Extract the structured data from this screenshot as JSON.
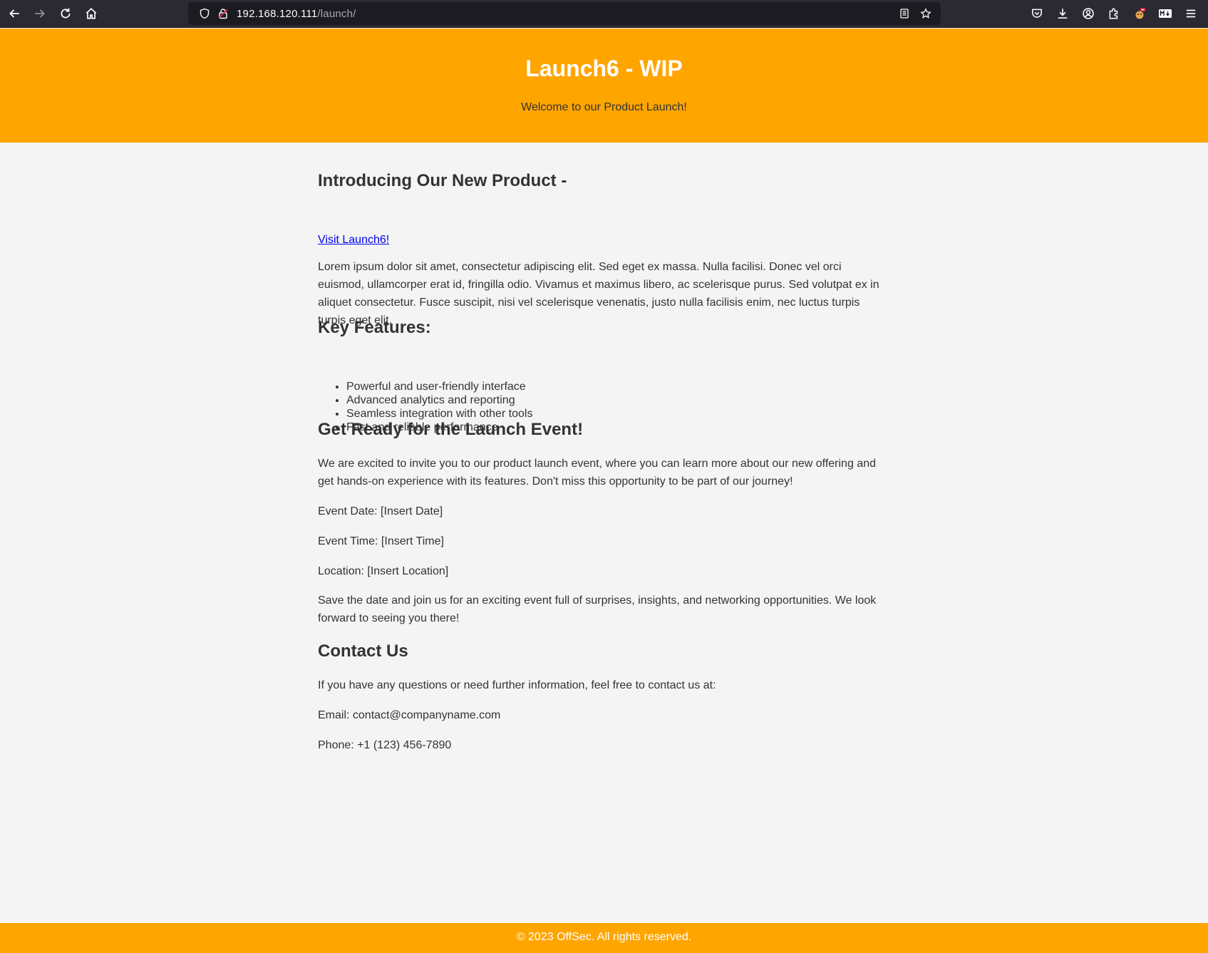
{
  "browser": {
    "url_host": "192.168.120.111",
    "url_path": "/launch/",
    "icons": {
      "back": "back-arrow-icon",
      "forward": "forward-arrow-icon",
      "reload": "reload-icon",
      "home": "home-icon",
      "shield": "tracking-protection-shield-icon",
      "lock": "insecure-lock-icon",
      "reader": "reader-view-icon",
      "bookmark": "bookmark-star-icon",
      "pocket": "pocket-icon",
      "downloads": "download-icon",
      "account": "account-icon",
      "extensions": "extensions-puzzle-icon",
      "ext1": "extension-icon",
      "ext2": "markdown-extension-icon",
      "menu": "hamburger-menu-icon"
    }
  },
  "header": {
    "title": "Launch6 - WIP",
    "tagline": "Welcome to our Product Launch!"
  },
  "intro": {
    "heading": "Introducing Our New Product -",
    "link_text": "Visit Launch6!",
    "paragraph": "Lorem ipsum dolor sit amet, consectetur adipiscing elit. Sed eget ex massa. Nulla facilisi. Donec vel orci euismod, ullamcorper erat id, fringilla odio. Vivamus et maximus libero, ac scelerisque purus. Sed volutpat ex in aliquet consectetur. Fusce suscipit, nisi vel scelerisque venenatis, justo nulla facilisis enim, nec luctus turpis turpis eget elit."
  },
  "features": {
    "heading": "Key Features:",
    "items": [
      "Powerful and user-friendly interface",
      "Advanced analytics and reporting",
      "Seamless integration with other tools",
      "Fast and reliable performance"
    ]
  },
  "event": {
    "heading": "Get Ready for the Launch Event!",
    "invite": "We are excited to invite you to our product launch event, where you can learn more about our new offering and get hands-on experience with its features. Don't miss this opportunity to be part of our journey!",
    "date": "Event Date: [Insert Date]",
    "time": "Event Time: [Insert Time]",
    "location": "Location: [Insert Location]",
    "closing": "Save the date and join us for an exciting event full of surprises, insights, and networking opportunities. We look forward to seeing you there!"
  },
  "contact": {
    "heading": "Contact Us",
    "intro": "If you have any questions or need further information, feel free to contact us at:",
    "email": "Email: contact@companyname.com",
    "phone": "Phone: +1 (123) 456-7890"
  },
  "footer": {
    "text": "© 2023 OffSec. All rights reserved."
  }
}
